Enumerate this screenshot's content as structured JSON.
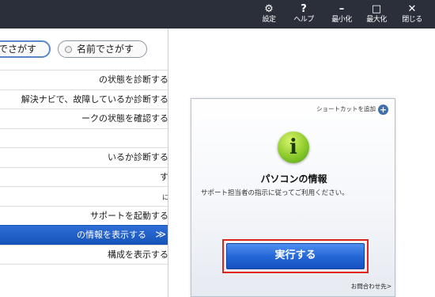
{
  "titlebar": {
    "buttons": [
      {
        "icon": "gear-icon",
        "glyph": "⚙",
        "label": "設定"
      },
      {
        "icon": "help-icon",
        "glyph": "?",
        "label": "ヘルプ"
      },
      {
        "icon": "minimize-icon",
        "glyph": "–",
        "label": "最小化"
      },
      {
        "icon": "maximize-icon",
        "glyph": "□",
        "label": "最大化"
      },
      {
        "icon": "close-icon",
        "glyph": "✕",
        "label": "閉じる"
      }
    ]
  },
  "search": {
    "active_tab": "でさがす",
    "other_tab": "名前でさがす"
  },
  "menu": {
    "items": [
      {
        "label": "の状態を診断する"
      },
      {
        "label": "解決ナビで、故障しているか診断する"
      },
      {
        "label": "ークの状態を確認する"
      },
      {
        "label": ""
      },
      {
        "label": "いるか診断する"
      },
      {
        "label": "す"
      },
      {
        "label": "に"
      },
      {
        "label": "サポートを起動する"
      },
      {
        "label": "の情報を表示する",
        "chevron": "≫"
      },
      {
        "label": "構成を表示する"
      }
    ]
  },
  "card": {
    "shortcut_label": "ショートカットを追加",
    "icon_glyph": "i",
    "title": "パソコンの情報",
    "description": "サポート担当者の指示に従ってご利用ください。",
    "run_button": "実行する",
    "contact_link": "お問合わせ先>"
  },
  "colors": {
    "titlebar_bg": "#2a2f3a",
    "selected_item": "#1e5fcc",
    "run_button": "#2668d8",
    "highlight_frame": "#e0241b",
    "info_icon": "#8ccb2b"
  }
}
